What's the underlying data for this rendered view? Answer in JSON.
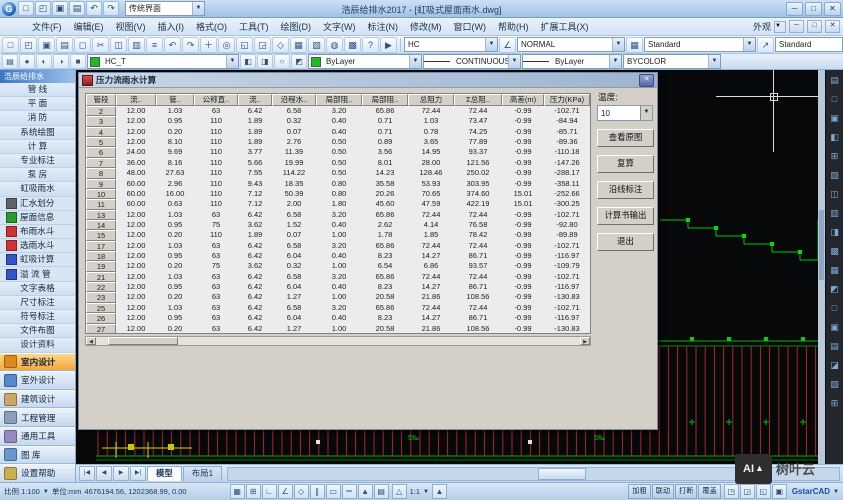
{
  "window": {
    "title": "浩辰给排水2017 - [虹吸式屋面雨水.dwg]",
    "workspace": "传统界面",
    "minimize": "─",
    "maximize": "□",
    "close": "✕"
  },
  "menu": {
    "items": [
      "文件(F)",
      "编辑(E)",
      "视图(V)",
      "插入(I)",
      "格式(O)",
      "工具(T)",
      "绘图(D)",
      "文字(W)",
      "标注(N)",
      "修改(M)",
      "窗口(W)",
      "帮助(H)",
      "扩展工具(X)"
    ],
    "appearance": "外观"
  },
  "toolbars": {
    "standard_icons": [
      "new",
      "open",
      "save",
      "print",
      "plot-preview",
      "cut",
      "copy",
      "paste",
      "format-painter",
      "undo",
      "redo",
      "pan",
      "zoom-realtime",
      "zoom-window",
      "zoom-previous",
      "redraw",
      "layer-manager",
      "layer-states",
      "group",
      "calculator",
      "help",
      "select"
    ],
    "text_style": "HC",
    "dim_style": "NORMAL",
    "table_style": "Standard",
    "mleader_style": "Standard",
    "layer_icons": [
      "print-layer",
      "layer-on",
      "layer-freeze",
      "layer-lock",
      "layer-current"
    ],
    "layer": "HC_T",
    "layer_tool_icons": [
      "layer-previous",
      "layer-isolate",
      "layer-off",
      "layer-match"
    ],
    "color": "ByLayer",
    "linetype": "CONTINUOUS",
    "lineweight": "ByLayer",
    "plot_style": "BYCOLOR"
  },
  "sidebar": {
    "title": "浩辰给排水",
    "groups": [
      "管  线",
      "平  面",
      "消  防",
      "系统绘图",
      "计  算",
      "专业标注",
      "泵  房",
      "虹吸雨水"
    ],
    "commands": [
      {
        "label": "汇水划分",
        "icon": "catchment-grid-icon",
        "color": "#606468"
      },
      {
        "label": "屋面信息",
        "icon": "roof-info-icon",
        "color": "#2a9c2a"
      },
      {
        "label": "布雨水斗",
        "icon": "place-drain-icon",
        "color": "#cc3333"
      },
      {
        "label": "选雨水斗",
        "icon": "select-drain-icon",
        "color": "#cc3333"
      },
      {
        "label": "虹吸计算",
        "icon": "siphon-calc-icon",
        "color": "#3355cc"
      },
      {
        "label": "溢 流 管",
        "icon": "overflow-pipe-icon",
        "color": "#3355cc"
      }
    ],
    "groups2": [
      "文字表格",
      "尺寸标注",
      "符号标注",
      "文件布图",
      "设计资料"
    ],
    "categories": [
      {
        "label": "室内设计",
        "color": "#e08820",
        "active": true
      },
      {
        "label": "室外设计",
        "color": "#5588cc",
        "active": false
      },
      {
        "label": "建筑设计",
        "color": "#caa868",
        "active": false
      },
      {
        "label": "工程管理",
        "color": "#88a0b8",
        "active": false
      },
      {
        "label": "通用工具",
        "color": "#9888c0",
        "active": false
      },
      {
        "label": "图    库",
        "color": "#6898d0",
        "active": false
      },
      {
        "label": "设置帮助",
        "color": "#c8b050",
        "active": false
      }
    ]
  },
  "dialog": {
    "title": "压力流雨水计算",
    "close": "✕",
    "temperature_label": "温度:",
    "temperature_value": "10",
    "buttons": [
      "查看原图",
      "复算",
      "沿线标注",
      "计算书输出",
      "退出"
    ],
    "table": {
      "columns": [
        "管段",
        "流..",
        "管..",
        "公称直..",
        "流..",
        "沿程水..",
        "局部阻..",
        "局部阻..",
        "总阻力",
        "Σ总阻..",
        "高差(m)",
        "压力(KPa)"
      ],
      "rows": [
        [
          "2",
          "12.00",
          "1.03",
          "63",
          "6.42",
          "6.58",
          "3.20",
          "65.86",
          "72.44",
          "72.44",
          "-0.99",
          "-102.71"
        ],
        [
          "3",
          "12.00",
          "0.95",
          "110",
          "1.89",
          "0.32",
          "0.40",
          "0.71",
          "1.03",
          "73.47",
          "-0.99",
          "-84.94"
        ],
        [
          "4",
          "12.00",
          "0.20",
          "110",
          "1.89",
          "0.07",
          "0.40",
          "0.71",
          "0.78",
          "74.25",
          "-0.99",
          "-85.71"
        ],
        [
          "5",
          "12.00",
          "8.10",
          "110",
          "1.89",
          "2.76",
          "0.50",
          "0.89",
          "3.65",
          "77.89",
          "-0.99",
          "-89.36"
        ],
        [
          "6",
          "24.00",
          "9.69",
          "110",
          "3.77",
          "11.39",
          "0.50",
          "3.56",
          "14.95",
          "93.37",
          "-0.99",
          "-110.18"
        ],
        [
          "7",
          "36.00",
          "8.16",
          "110",
          "5.66",
          "19.99",
          "0.50",
          "8.01",
          "28.00",
          "121.56",
          "-0.99",
          "-147.26"
        ],
        [
          "8",
          "48.00",
          "27.63",
          "110",
          "7.55",
          "114.22",
          "0.50",
          "14.23",
          "128.46",
          "250.02",
          "-0.99",
          "-288.17"
        ],
        [
          "9",
          "60.00",
          "2.96",
          "110",
          "9.43",
          "18.35",
          "0.80",
          "35.58",
          "53.93",
          "303.95",
          "-0.99",
          "-358.11"
        ],
        [
          "10",
          "60.00",
          "16.00",
          "110",
          "7.12",
          "50.39",
          "0.80",
          "20.26",
          "70.65",
          "374.60",
          "15.01",
          "-252.66"
        ],
        [
          "11",
          "60.00",
          "0.63",
          "110",
          "7.12",
          "2.00",
          "1.80",
          "45.60",
          "47.59",
          "422.19",
          "15.01",
          "-300.25"
        ],
        [
          "13",
          "12.00",
          "1.03",
          "63",
          "6.42",
          "6.58",
          "3.20",
          "65.86",
          "72.44",
          "72.44",
          "-0.99",
          "-102.71"
        ],
        [
          "14",
          "12.00",
          "0.95",
          "75",
          "3.62",
          "1.52",
          "0.40",
          "2.62",
          "4.14",
          "76.58",
          "-0.99",
          "-92.80"
        ],
        [
          "15",
          "12.00",
          "0.20",
          "110",
          "1.89",
          "0.07",
          "1.00",
          "1.78",
          "1.85",
          "78.42",
          "-0.99",
          "-89.89"
        ],
        [
          "17",
          "12.00",
          "1.03",
          "63",
          "6.42",
          "6.58",
          "3.20",
          "65.86",
          "72.44",
          "72.44",
          "-0.99",
          "-102.71"
        ],
        [
          "18",
          "12.00",
          "0.95",
          "63",
          "6.42",
          "6.04",
          "0.40",
          "8.23",
          "14.27",
          "86.71",
          "-0.99",
          "-116.97"
        ],
        [
          "19",
          "12.00",
          "0.20",
          "75",
          "3.62",
          "0.32",
          "1.00",
          "6.54",
          "6.86",
          "93.57",
          "-0.99",
          "-109.79"
        ],
        [
          "21",
          "12.00",
          "1.03",
          "63",
          "6.42",
          "6.58",
          "3.20",
          "65.86",
          "72.44",
          "72.44",
          "-0.99",
          "-102.71"
        ],
        [
          "22",
          "12.00",
          "0.95",
          "63",
          "6.42",
          "6.04",
          "0.40",
          "8.23",
          "14.27",
          "86.71",
          "-0.99",
          "-116.97"
        ],
        [
          "23",
          "12.00",
          "0.20",
          "63",
          "6.42",
          "1.27",
          "1.00",
          "20.58",
          "21.86",
          "108.56",
          "-0.99",
          "-130.83"
        ],
        [
          "25",
          "12.00",
          "1.03",
          "63",
          "6.42",
          "6.58",
          "3.20",
          "65.86",
          "72.44",
          "72.44",
          "-0.99",
          "-102.71"
        ],
        [
          "26",
          "12.00",
          "0.95",
          "63",
          "6.42",
          "6.04",
          "0.40",
          "8.23",
          "14.27",
          "86.71",
          "-0.99",
          "-116.97"
        ],
        [
          "27",
          "12.00",
          "0.20",
          "63",
          "6.42",
          "1.27",
          "1.00",
          "20.58",
          "21.86",
          "108.56",
          "-0.99",
          "-130.83"
        ]
      ]
    }
  },
  "canvas": {
    "slope_labels": [
      "5‰",
      "5‰"
    ]
  },
  "tabs": {
    "nav": [
      "|◀",
      "◀",
      "▶",
      "▶|"
    ],
    "items": [
      "模型",
      "布局1"
    ]
  },
  "status": {
    "scale": "比例 1:100",
    "units": "单位:mm",
    "coords": "4676194.56, 1202368.99, 0.00",
    "mode_icons": [
      "snap",
      "grid",
      "ortho",
      "polar",
      "osnap",
      "otrack",
      "dyn",
      "lwt",
      "model-space",
      "annotation"
    ],
    "annotation_scale": "1:1",
    "toggles": [
      "加粗",
      "联动",
      "打断",
      "覆盖"
    ],
    "right_icons": [
      "clean-screen",
      "isolate",
      "lock-ui",
      "workspace"
    ],
    "brand": "GstarCAD"
  },
  "watermark": {
    "logo": "AI",
    "text": "树叶云"
  }
}
